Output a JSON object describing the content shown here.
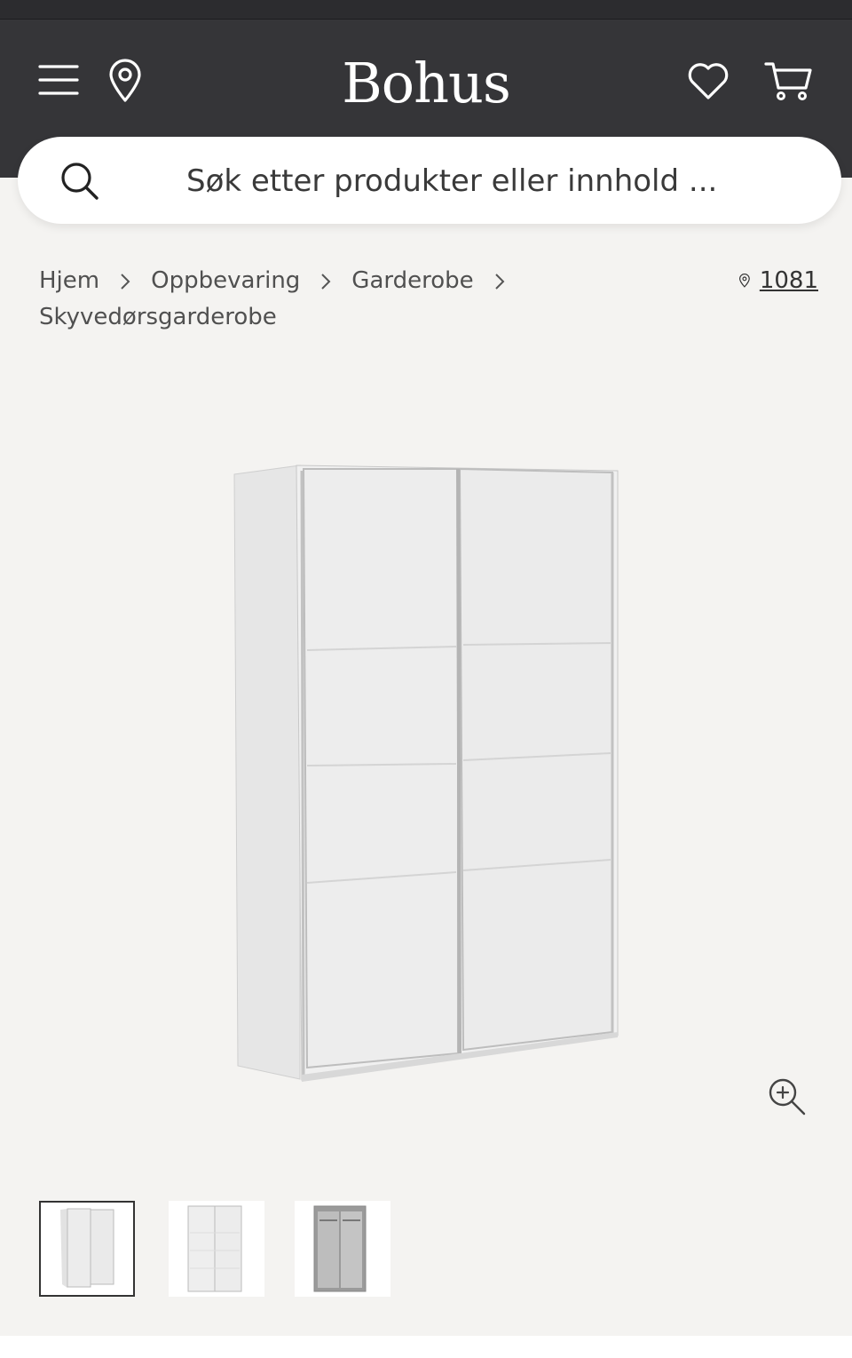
{
  "header": {
    "logo": "Bohus",
    "menu_icon": "hamburger-menu-icon",
    "location_icon": "map-pin-icon",
    "wishlist_icon": "heart-icon",
    "cart_icon": "shopping-cart-icon"
  },
  "search": {
    "placeholder": "Søk etter produkter eller innhold ...",
    "icon": "search-icon"
  },
  "breadcrumb": {
    "items": [
      "Hjem",
      "Oppbevaring",
      "Garderobe"
    ],
    "current": "Skyvedørsgarderobe",
    "separator_icon": "chevron-right-icon"
  },
  "store": {
    "code": "1081",
    "icon": "map-pin-icon"
  },
  "gallery": {
    "main_image": "white-sliding-door-wardrobe",
    "zoom_icon": "zoom-in-icon",
    "thumbnails": [
      {
        "image": "wardrobe-closed-angle",
        "selected": true
      },
      {
        "image": "wardrobe-closed-front",
        "selected": false
      },
      {
        "image": "wardrobe-open-interior",
        "selected": false
      }
    ]
  },
  "colors": {
    "header_bg": "#353538",
    "page_bg": "#f4f3f1",
    "text": "#505050"
  }
}
